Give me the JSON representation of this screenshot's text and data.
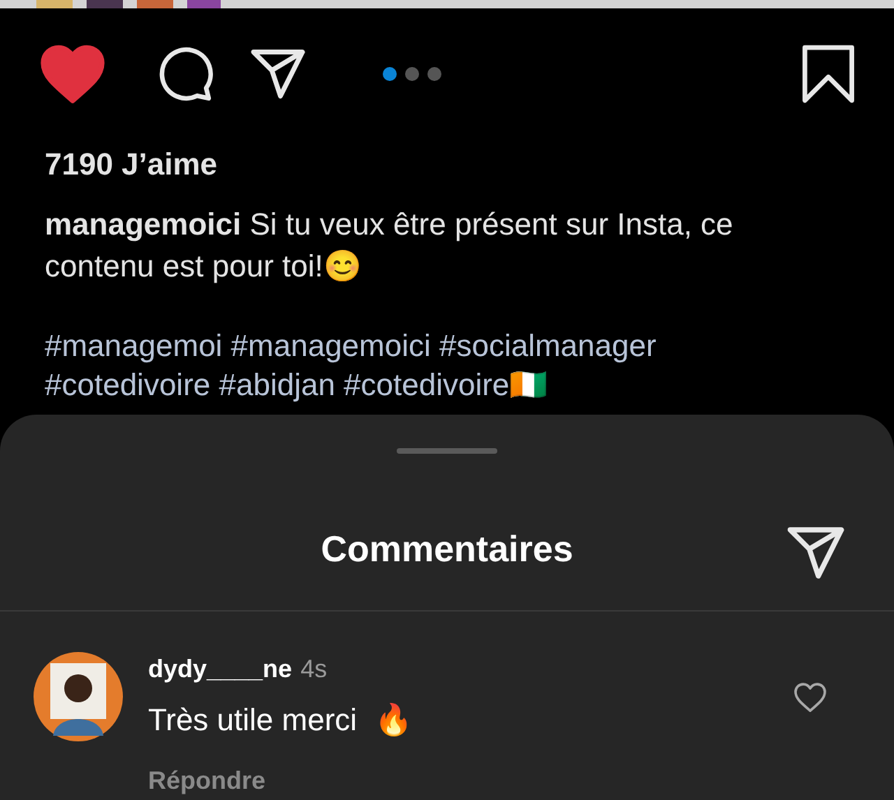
{
  "post": {
    "liked": true,
    "carousel_dots": [
      {
        "selected": true
      },
      {
        "selected": false
      },
      {
        "selected": false
      }
    ],
    "likes": "7190 J’aime",
    "caption_user": "managemoici",
    "caption_text": "Si tu veux être présent sur Insta, ce contenu est pour toi!😊",
    "hashtags": [
      "#managemoi #managemoici #socialmanager",
      "#cotedivoire #abidjan #cotedivoire🇨🇮"
    ]
  },
  "comments_sheet": {
    "title": "Commentaires",
    "comments": [
      {
        "user": "dydy____ne",
        "time": "4s",
        "text": "Très utile merci  🔥",
        "reply": "Répondre",
        "liked": false
      }
    ]
  }
}
